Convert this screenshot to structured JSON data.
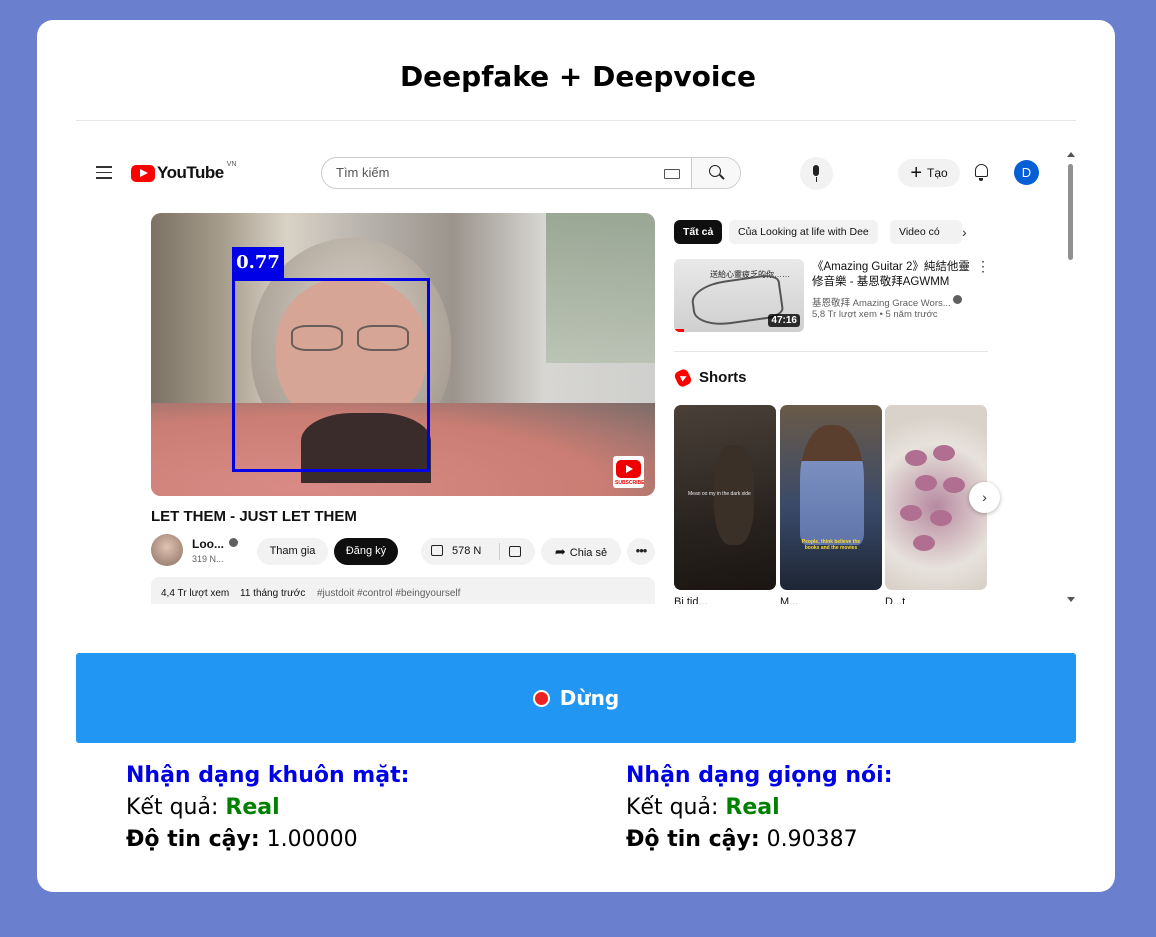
{
  "app": {
    "title": "Deepfake + Deepvoice"
  },
  "youtube": {
    "logo_text": "YouTube",
    "country_code": "VN",
    "search_placeholder": "Tìm kiếm",
    "create_label": "Tạo",
    "avatar_letter": "D",
    "video": {
      "detection_score": "0.77",
      "title": "LET THEM - JUST LET THEM",
      "channel_name": "Loo...",
      "subscribers": "319 N...",
      "join_label": "Tham gia",
      "subscribe_label": "Đăng ký",
      "likes": "578 N",
      "share_label": "Chia sẻ",
      "views": "4,4 Tr lượt xem",
      "published": "11 tháng trước",
      "tags": "#justdoit #control #beingyourself"
    },
    "filter_chips": [
      "Tất cả",
      "Của Looking at life with Dee",
      "Video có"
    ],
    "recommendation": {
      "title": "《Amazing Guitar 2》純結他靈修音樂 - 基恩敬拜AGWMM",
      "channel": "基恩敬拜 Amazing Grace Wors...",
      "meta": "5,8 Tr lượt xem  •  5 năm trước",
      "duration": "47:16",
      "thumb_text": "送給心靈疲乏的你……"
    },
    "shorts": {
      "label": "Shorts",
      "items": [
        {
          "title": "Bi tid...",
          "caption": "Mean oo my in the dark side"
        },
        {
          "title": "M...",
          "caption": "People, think believe the books and the movies"
        },
        {
          "title": "D...t"
        }
      ]
    }
  },
  "controls": {
    "stop_label": "Dừng"
  },
  "results": {
    "face": {
      "heading": "Nhận dạng khuôn mặt:",
      "result_label": "Kết quả:",
      "result_value": "Real",
      "confidence_label": "Độ tin cậy:",
      "confidence_value": "1.00000"
    },
    "voice": {
      "heading": "Nhận dạng giọng nói:",
      "result_label": "Kết quả:",
      "result_value": "Real",
      "confidence_label": "Độ tin cậy:",
      "confidence_value": "0.90387"
    }
  },
  "colors": {
    "background": "#6b7fcf",
    "button": "#2196f3",
    "heading": "#0000e6",
    "real": "#008000",
    "detect_box": "#0000e6"
  }
}
